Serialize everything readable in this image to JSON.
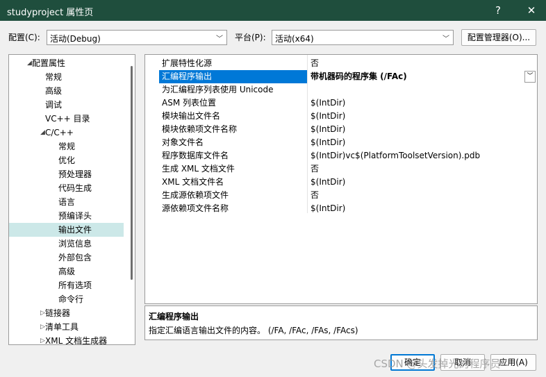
{
  "window": {
    "title": "studyproject 属性页",
    "help": "?",
    "close": "✕"
  },
  "config": {
    "label": "配置(C):",
    "value": "活动(Debug)",
    "platform_label": "平台(P):",
    "platform_value": "活动(x64)",
    "manager_button": "配置管理器(O)..."
  },
  "tree": [
    {
      "label": "配置属性",
      "expander": "◢",
      "level": 0
    },
    {
      "label": "常规",
      "level": 1
    },
    {
      "label": "高级",
      "level": 1
    },
    {
      "label": "调试",
      "level": 1
    },
    {
      "label": "VC++ 目录",
      "level": 1
    },
    {
      "label": "C/C++",
      "expander": "◢",
      "level": 1
    },
    {
      "label": "常规",
      "level": 2
    },
    {
      "label": "优化",
      "level": 2
    },
    {
      "label": "预处理器",
      "level": 2
    },
    {
      "label": "代码生成",
      "level": 2
    },
    {
      "label": "语言",
      "level": 2
    },
    {
      "label": "预编译头",
      "level": 2
    },
    {
      "label": "输出文件",
      "level": 2,
      "selected": true
    },
    {
      "label": "浏览信息",
      "level": 2
    },
    {
      "label": "外部包含",
      "level": 2
    },
    {
      "label": "高级",
      "level": 2
    },
    {
      "label": "所有选项",
      "level": 2
    },
    {
      "label": "命令行",
      "level": 2
    },
    {
      "label": "链接器",
      "expander": "▷",
      "level": 1
    },
    {
      "label": "清单工具",
      "expander": "▷",
      "level": 1
    },
    {
      "label": "XML 文档生成器",
      "expander": "▷",
      "level": 1
    }
  ],
  "properties": [
    {
      "name": "扩展特性化源",
      "value": "否"
    },
    {
      "name": "汇编程序输出",
      "value": "带机器码的程序集 (/FAc)",
      "selected": true
    },
    {
      "name": "为汇编程序列表使用 Unicode",
      "value": ""
    },
    {
      "name": "ASM 列表位置",
      "value": "$(IntDir)"
    },
    {
      "name": "模块输出文件名",
      "value": "$(IntDir)"
    },
    {
      "name": "模块依赖项文件名称",
      "value": "$(IntDir)"
    },
    {
      "name": "对象文件名",
      "value": "$(IntDir)"
    },
    {
      "name": "程序数据库文件名",
      "value": "$(IntDir)vc$(PlatformToolsetVersion).pdb"
    },
    {
      "name": "生成 XML 文档文件",
      "value": "否"
    },
    {
      "name": "XML 文档文件名",
      "value": "$(IntDir)"
    },
    {
      "name": "生成源依赖项文件",
      "value": "否"
    },
    {
      "name": "源依赖项文件名称",
      "value": "$(IntDir)"
    }
  ],
  "description": {
    "title": "汇编程序输出",
    "text": "指定汇编语言输出文件的内容。     (/FA, /FAc, /FAs, /FAcs)"
  },
  "buttons": {
    "ok": "确定",
    "cancel": "取消",
    "apply": "应用(A)"
  },
  "watermark": "CSDN @头发掉光的程序员"
}
